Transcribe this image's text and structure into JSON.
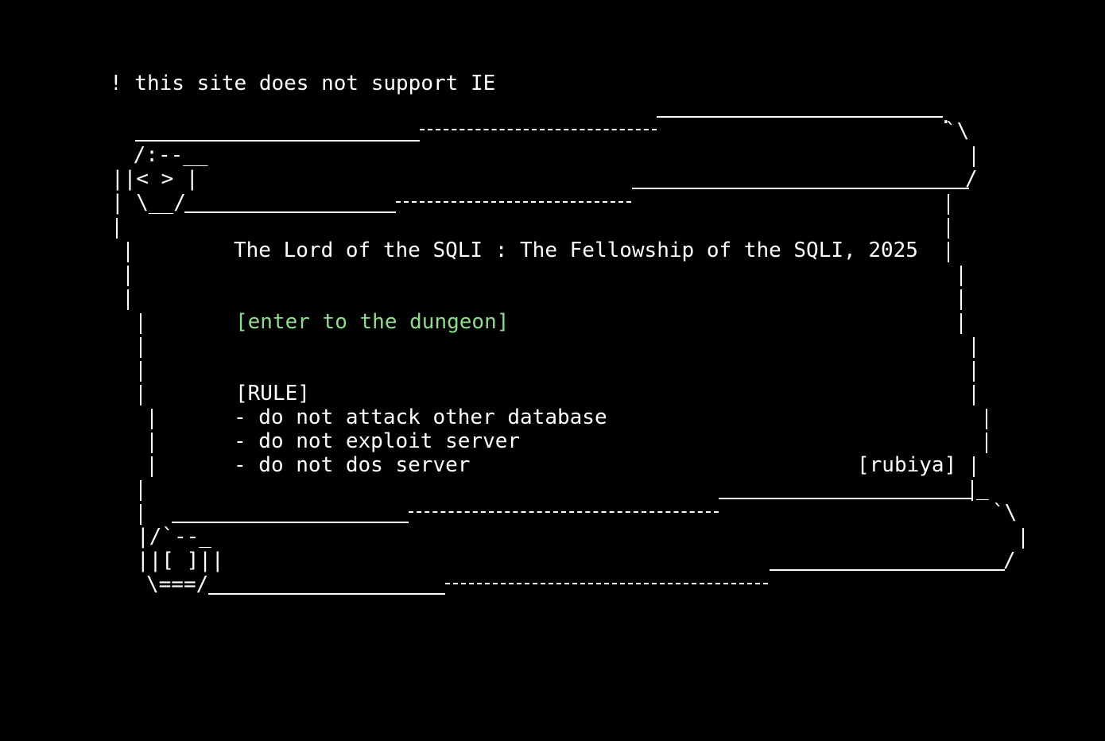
{
  "notice": "! this site does not support IE",
  "title": "The Lord of the SQLI : The Fellowship of the SQLI, 2025",
  "enter_link": "[enter to the dungeon]",
  "rules": {
    "heading": "[RULE]",
    "items": [
      "- do not attack other database",
      "- do not exploit server",
      "- do not dos server"
    ]
  },
  "signature": "[rubiya]",
  "colors": {
    "background": "#000000",
    "text": "#ffffff",
    "link": "#8fdc8f"
  }
}
